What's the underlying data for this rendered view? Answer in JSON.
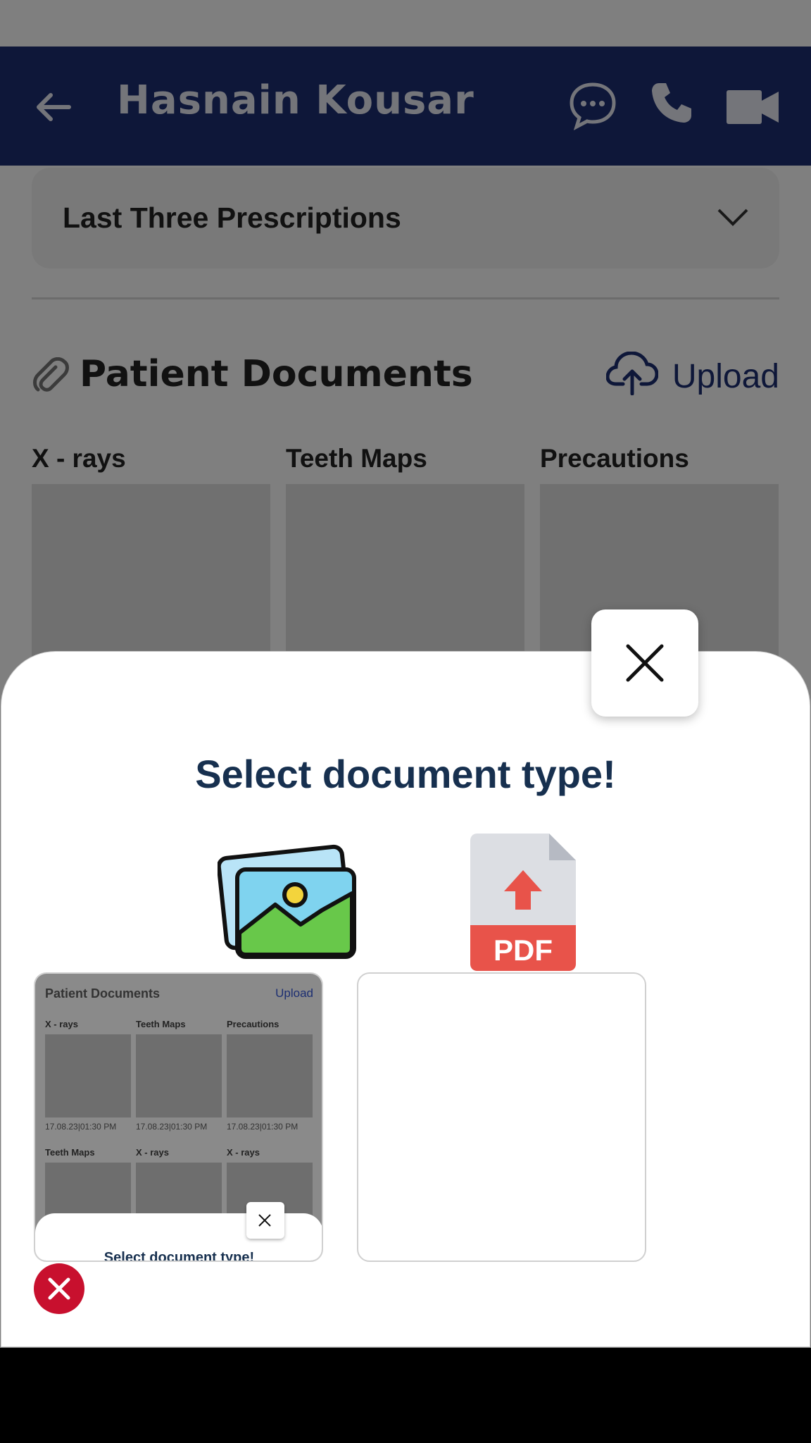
{
  "header": {
    "title": "Hasnain Kousar"
  },
  "prescriptions": {
    "label": "Last Three Prescriptions"
  },
  "documents": {
    "title": "Patient Documents",
    "upload_label": "Upload",
    "columns": [
      "X - rays",
      "Teeth Maps",
      "Precautions"
    ]
  },
  "modal": {
    "title": "Select document type!",
    "options": [
      "image-gallery-icon",
      "pdf-upload-icon"
    ]
  },
  "preview": {
    "title": "Patient Documents",
    "upload_label": "Upload",
    "row1": [
      "X - rays",
      "Teeth Maps",
      "Precautions"
    ],
    "dates": [
      "17.08.23|01:30 PM",
      "17.08.23|01:30 PM",
      "17.08.23|01:30 PM"
    ],
    "row2": [
      "Teeth Maps",
      "X - rays",
      "X - rays"
    ],
    "sheet_title": "Select document type!"
  },
  "icons": {
    "back": "arrow-left-icon",
    "chat": "chat-bubble-icon",
    "call": "phone-icon",
    "video": "video-camera-icon",
    "clip": "paperclip-icon",
    "upload": "cloud-upload-icon",
    "chevron": "chevron-down-icon",
    "close": "close-icon",
    "remove": "remove-icon"
  },
  "colors": {
    "appbar": "#1c2e72",
    "modal_title": "#17304f",
    "remove": "#c8102e"
  }
}
